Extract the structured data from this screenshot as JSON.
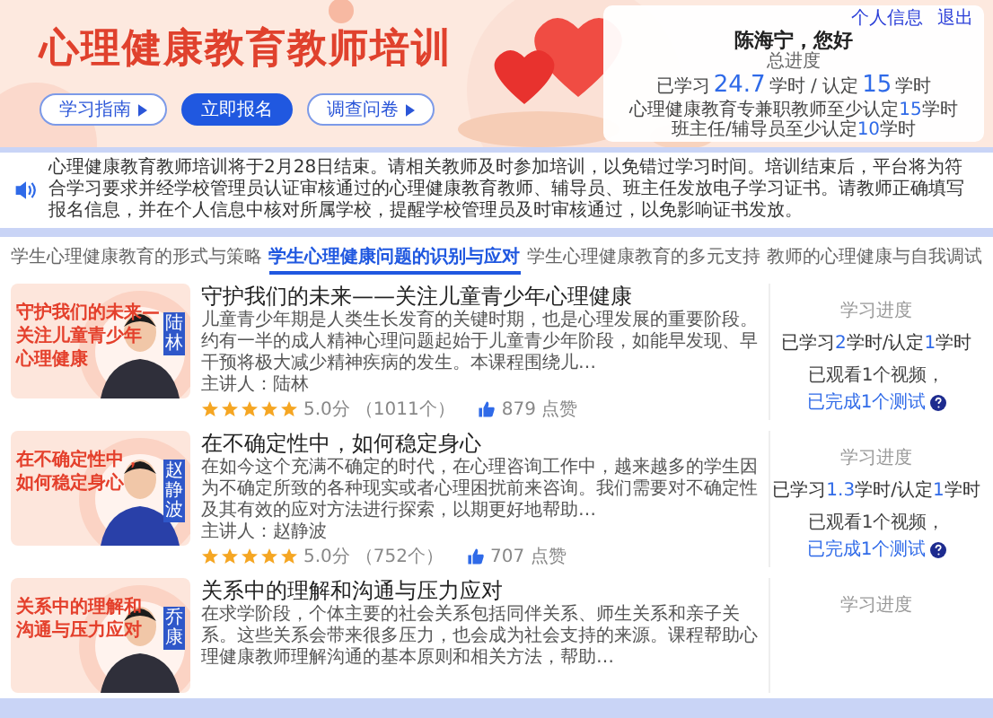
{
  "banner": {
    "title": "心理健康教育教师培训",
    "buttons": [
      {
        "label": "学习指南",
        "kind": "outline"
      },
      {
        "label": "立即报名",
        "kind": "primary"
      },
      {
        "label": "调查问卷",
        "kind": "outline"
      }
    ],
    "user_panel": {
      "links": [
        "个人信息",
        "退出"
      ],
      "greeting": "陈海宁，您好",
      "progress_label": "总进度",
      "reading": [
        "已学习",
        "24.7",
        "学时 / 认定",
        "15",
        "学时"
      ],
      "requirements": [
        [
          "心理健康教育专兼职教师至少认定",
          "15",
          "学时"
        ],
        [
          "班主任/辅导员至少认定",
          "10",
          "学时"
        ]
      ]
    }
  },
  "notice": "心理健康教育教师培训将于2月28日结束。请相关教师及时参加培训，以免错过学习时间。培训结束后，平台将为符合学习要求并经学校管理员认证审核通过的心理健康教育教师、辅导员、班主任发放电子学习证书。请教师正确填写报名信息，并在个人信息中核对所属学校，提醒学校管理员及时审核通过，以免影响证书发放。",
  "tabs": [
    {
      "label": "学生心理健康教育的形式与策略",
      "selected": false
    },
    {
      "label": "学生心理健康问题的识别与应对",
      "selected": true
    },
    {
      "label": "学生心理健康教育的多元支持",
      "selected": false
    },
    {
      "label": "教师的心理健康与自我调试",
      "selected": false
    }
  ],
  "courses": [
    {
      "thumb": {
        "caption": [
          "守护我们的未来—",
          "关注儿童青少年",
          "心理健康"
        ],
        "name_tag": "陆林"
      },
      "title": "守护我们的未来——关注儿童青少年心理健康",
      "description": "儿童青少年期是人类生长发育的关键时期，也是心理发展的重要阶段。约有一半的成人精神心理问题起始于儿童青少年阶段，如能早发现、早干预将极大减少精神疾病的发生。本课程围绕儿…",
      "lecturer": "主讲人：陆林",
      "stars": 5,
      "score": "5.0分",
      "rating_count": "（1011个）",
      "likes": "879 点赞",
      "progress": {
        "label": "学习进度",
        "reading": [
          "已学习",
          "2",
          "学时/认定",
          "1",
          "学时"
        ],
        "detail": [
          "已观看1个视频，",
          "已完成1个测试"
        ]
      }
    },
    {
      "thumb": {
        "caption": [
          "在不确定性中，",
          "如何稳定身心"
        ],
        "name_tag": "赵静波"
      },
      "title": "在不确定性中，如何稳定身心",
      "description": "在如今这个充满不确定的时代，在心理咨询工作中，越来越多的学生因为不确定所致的各种现实或者心理困扰前来咨询。我们需要对不确定性及其有效的应对方法进行探索，以期更好地帮助…",
      "lecturer": "主讲人：赵静波",
      "stars": 5,
      "score": "5.0分",
      "rating_count": "（752个）",
      "likes": "707 点赞",
      "progress": {
        "label": "学习进度",
        "reading": [
          "已学习",
          "1.3",
          "学时/认定",
          "1",
          "学时"
        ],
        "detail": [
          "已观看1个视频，",
          "已完成1个测试"
        ]
      }
    },
    {
      "thumb": {
        "caption": [
          "关系中的理解和",
          "沟通与压力应对"
        ],
        "name_tag": "乔康"
      },
      "title": "关系中的理解和沟通与压力应对",
      "description": "在求学阶段，个体主要的社会关系包括同伴关系、师生关系和亲子关系。这些关系会带来很多压力，也会成为社会支持的来源。课程帮助心理健康教师理解沟通的基本原则和相关方法，帮助…",
      "progress": {
        "label": "学习进度"
      }
    }
  ]
}
